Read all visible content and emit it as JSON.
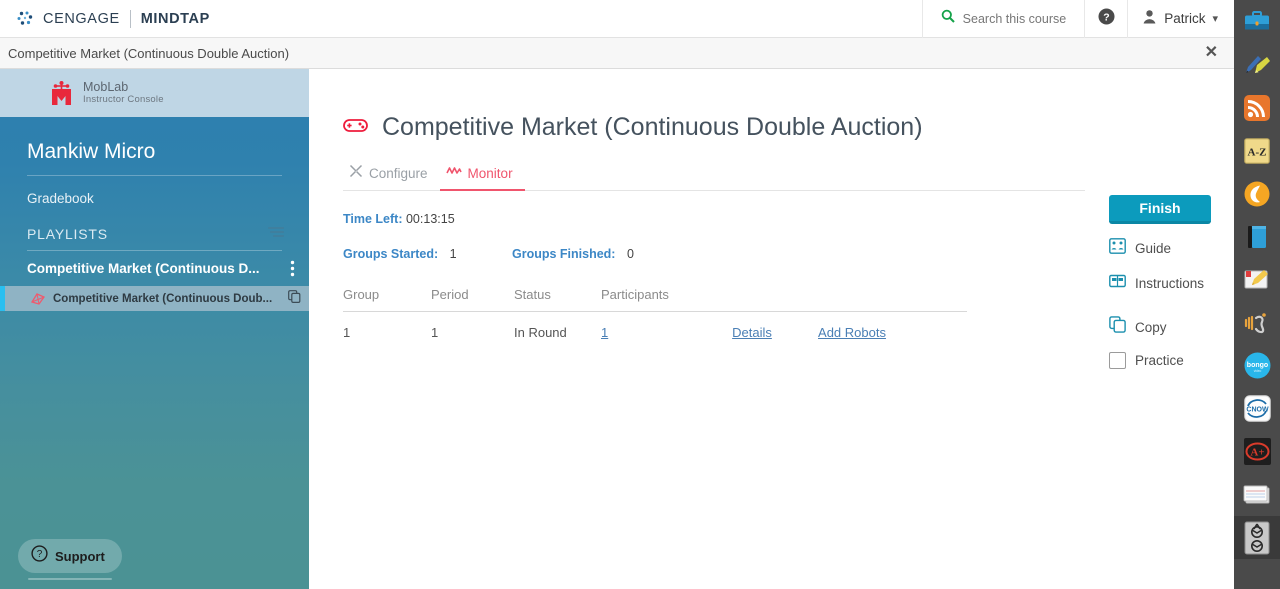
{
  "topbar": {
    "brand_primary": "CENGAGE",
    "brand_secondary": "MINDTAP",
    "search_label": "Search this course",
    "search_icon": "search-icon",
    "help_icon": "help-circle-icon",
    "user_name": "Patrick",
    "user_icon": "person-icon",
    "caret": "⌄"
  },
  "subheader": {
    "title": "Competitive Market (Continuous Double Auction)",
    "close": "✕"
  },
  "sidebar": {
    "moblab": {
      "name": "MobLab",
      "subtitle": "Instructor Console",
      "logo_icon": "moblab-logo-icon"
    },
    "course_title": "Mankiw Micro",
    "gradebook": "Gradebook",
    "playlists_label": "PLAYLISTS",
    "filter_icon": "filter-icon",
    "playlist": {
      "name": "Competitive Market (Continuous D...",
      "kebab_icon": "kebab-menu-icon"
    },
    "playlist_child": {
      "name": "Competitive Market (Continuous Doub...",
      "game_icon": "game-kite-icon",
      "copy_icon": "copy-icon"
    },
    "support": {
      "label": "Support",
      "icon": "question-circle-icon"
    }
  },
  "main": {
    "page_title": "Competitive Market (Continuous Double Auction)",
    "title_icon": "gamepad-icon",
    "tabs": [
      {
        "label": "Configure",
        "icon": "wrench-icon",
        "active": false
      },
      {
        "label": "Monitor",
        "icon": "pulse-icon",
        "active": true
      }
    ],
    "time_left_label": "Time Left:",
    "time_left_value": "00:13:15",
    "groups_started_label": "Groups Started:",
    "groups_started_value": "1",
    "groups_finished_label": "Groups Finished:",
    "groups_finished_value": "0",
    "table": {
      "headers": [
        "Group",
        "Period",
        "Status",
        "Participants",
        "",
        ""
      ],
      "rows": [
        {
          "group": "1",
          "period": "1",
          "status": "In Round",
          "participants": "1",
          "action_details": "Details",
          "action_add_robots": "Add Robots"
        }
      ]
    },
    "highlight_color": "#ee1c25"
  },
  "actions": {
    "finish": "Finish",
    "guide": "Guide",
    "guide_icon": "guide-book-icon",
    "instructions": "Instructions",
    "instructions_icon": "instructions-icon",
    "copy": "Copy",
    "copy_icon": "copy-icon",
    "practice": "Practice",
    "practice_checkbox": "practice-checkbox"
  },
  "iconstrip": {
    "items": [
      {
        "name": "briefcase-icon",
        "color": "#2e9fd8"
      },
      {
        "name": "pencil-highlighter-icon",
        "color": "#d8d642"
      },
      {
        "name": "rss-icon",
        "color": "#e8762c"
      },
      {
        "name": "a-z-glossary-icon",
        "color": "#f0d98a"
      },
      {
        "name": "brightspace-icon",
        "color": "#f5a623"
      },
      {
        "name": "ebook-icon",
        "color": "#2e9fd8"
      },
      {
        "name": "notepad-pencil-icon",
        "color": "#f2c94c"
      },
      {
        "name": "audio-speech-icon",
        "color": "#e8a33d"
      },
      {
        "name": "bongo-icon",
        "color": "#29b6ea"
      },
      {
        "name": "cnow-icon",
        "color": "#1b6ca8"
      },
      {
        "name": "aplus-grade-icon",
        "color": "#d93b2b"
      },
      {
        "name": "index-card-icon",
        "color": "#e8e8e8"
      },
      {
        "name": "accessibility-icon",
        "color": "#cccccc"
      }
    ]
  }
}
